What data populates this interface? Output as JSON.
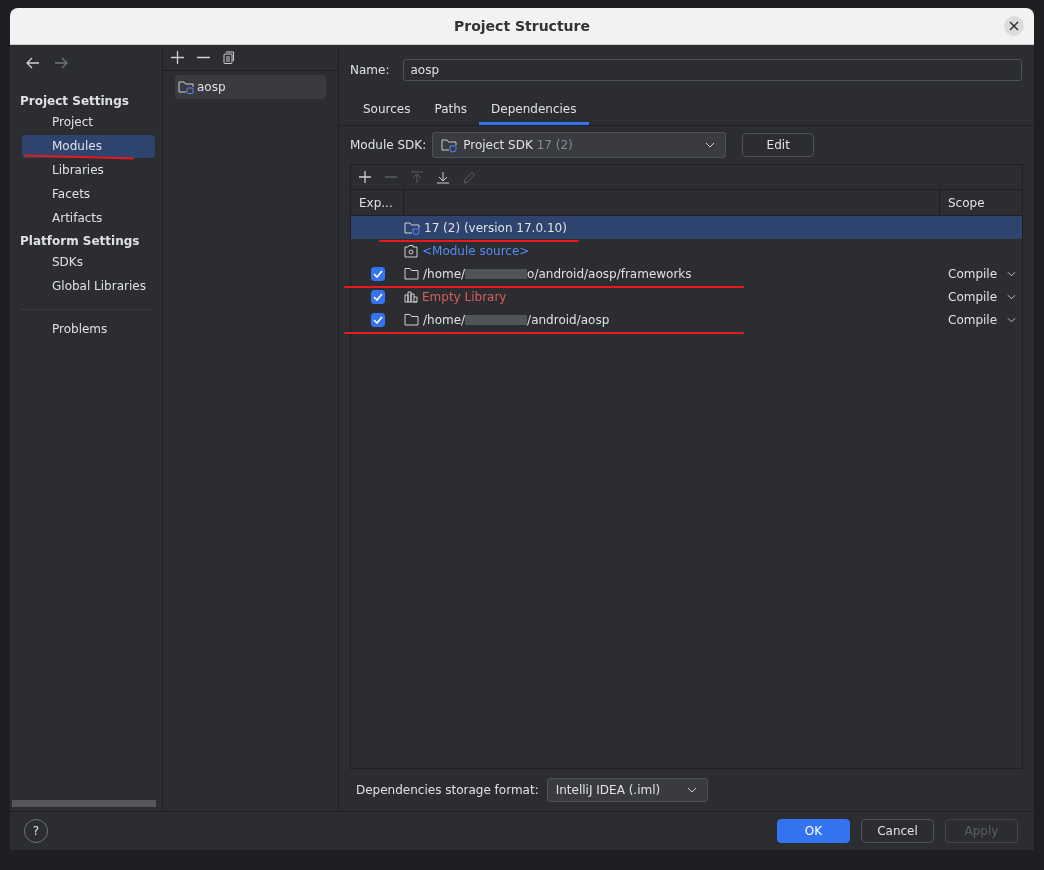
{
  "window": {
    "title": "Project Structure"
  },
  "sidebar": {
    "groups": [
      {
        "title": "Project Settings",
        "items": [
          {
            "label": "Project",
            "selected": false,
            "underlined": false
          },
          {
            "label": "Modules",
            "selected": true,
            "underlined": true
          },
          {
            "label": "Libraries",
            "selected": false,
            "underlined": false
          },
          {
            "label": "Facets",
            "selected": false,
            "underlined": false
          },
          {
            "label": "Artifacts",
            "selected": false,
            "underlined": false
          }
        ]
      },
      {
        "title": "Platform Settings",
        "items": [
          {
            "label": "SDKs",
            "selected": false,
            "underlined": false
          },
          {
            "label": "Global Libraries",
            "selected": false,
            "underlined": false
          }
        ]
      }
    ],
    "footer_items": [
      {
        "label": "Problems",
        "selected": false,
        "underlined": false
      }
    ]
  },
  "modules": [
    {
      "label": "aosp",
      "selected": true
    }
  ],
  "name_field": {
    "label": "Name:",
    "value": "aosp"
  },
  "tabs": [
    {
      "label": "Sources",
      "selected": false
    },
    {
      "label": "Paths",
      "selected": false
    },
    {
      "label": "Dependencies",
      "selected": true
    }
  ],
  "module_sdk": {
    "label": "Module SDK:",
    "value": "Project SDK",
    "detail": "17 (2)",
    "button": "Edit"
  },
  "table": {
    "columns": [
      "Exp...",
      "Scope"
    ],
    "rows": [
      {
        "kind": "sdk",
        "text": "17 (2) (version 17.0.10)",
        "selected": true,
        "underlined": true
      },
      {
        "kind": "source",
        "text": "<Module source>",
        "selected": false,
        "underlined": false
      },
      {
        "kind": "folder",
        "text": "/home/",
        "text_end": "o/android/aosp/frameworks",
        "exported": true,
        "scope": "Compile",
        "selected": false,
        "underlined": true
      },
      {
        "kind": "library",
        "text": "Empty Library",
        "exported": true,
        "scope": "Compile",
        "selected": false,
        "underlined": false
      },
      {
        "kind": "folder",
        "text": "/home/",
        "text_end": "/android/aosp",
        "exported": true,
        "scope": "Compile",
        "selected": false,
        "underlined": true
      }
    ]
  },
  "storage_format": {
    "label": "Dependencies storage format:",
    "value": "IntelliJ IDEA (.iml)"
  },
  "help_button": "?",
  "buttons": [
    {
      "label": "OK",
      "kind": "primary",
      "disabled": false
    },
    {
      "label": "Cancel",
      "kind": "normal",
      "disabled": false
    },
    {
      "label": "Apply",
      "kind": "normal",
      "disabled": true
    }
  ]
}
